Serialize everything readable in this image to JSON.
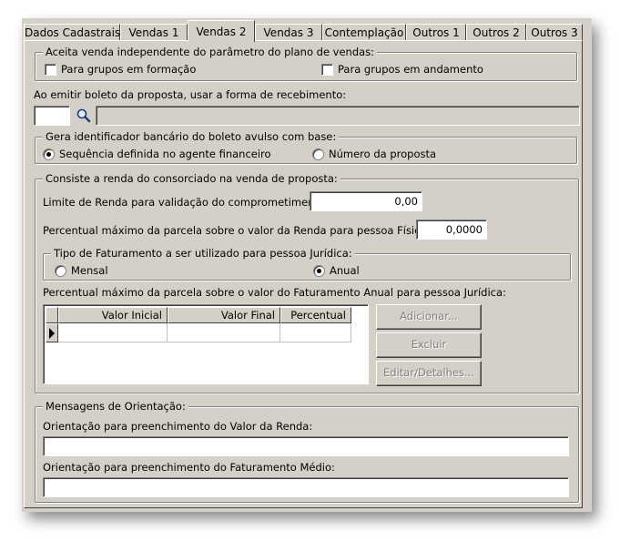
{
  "tabs": [
    {
      "label": "Dados Cadastrais",
      "active": false
    },
    {
      "label": "Vendas 1",
      "active": false
    },
    {
      "label": "Vendas 2",
      "active": true
    },
    {
      "label": "Vendas 3",
      "active": false
    },
    {
      "label": "Contemplação",
      "active": false
    },
    {
      "label": "Outros 1",
      "active": false
    },
    {
      "label": "Outros 2",
      "active": false
    },
    {
      "label": "Outros 3",
      "active": false
    }
  ],
  "aceita": {
    "legend": "Aceita venda independente do parâmetro do plano de vendas:",
    "formacao_label": "Para grupos em formação",
    "andamento_label": "Para grupos em andamento"
  },
  "boleto": {
    "label": "Ao emitir boleto da proposta, usar a forma de recebimento:",
    "code": "",
    "description": ""
  },
  "identificador": {
    "legend": "Gera identificador bancário do boleto avulso com base:",
    "opt1": "Sequência definida no agente financeiro",
    "opt2": "Número da proposta",
    "selected": "opt1"
  },
  "renda": {
    "legend": "Consiste a renda do consorciado na venda de proposta:",
    "limite_label": "Limite de Renda para validação do comprometimento:",
    "limite_value": "0,00",
    "percentual_label": "Percentual máximo da parcela sobre o valor da Renda para pessoa Física:",
    "percentual_value": "0,0000",
    "faturamento": {
      "legend": "Tipo de Faturamento a ser utilizado para pessoa Jurídica:",
      "mensal": "Mensal",
      "anual": "Anual",
      "selected": "anual"
    },
    "pj_label": "Percentual máximo da parcela sobre o valor do Faturamento Anual para pessoa Jurídica:",
    "grid": {
      "columns": [
        "Valor Inicial",
        "Valor Final",
        "Percentual"
      ]
    },
    "buttons": {
      "adicionar": "Adicionar...",
      "excluir": "Excluir",
      "editar": "Editar/Detalhes..."
    }
  },
  "mensagens": {
    "legend": "Mensagens de Orientação:",
    "renda_label": "Orientação para preenchimento do Valor da Renda:",
    "renda_value": "",
    "faturamento_label": "Orientação para preenchimento do Faturamento Médio:",
    "faturamento_value": ""
  }
}
